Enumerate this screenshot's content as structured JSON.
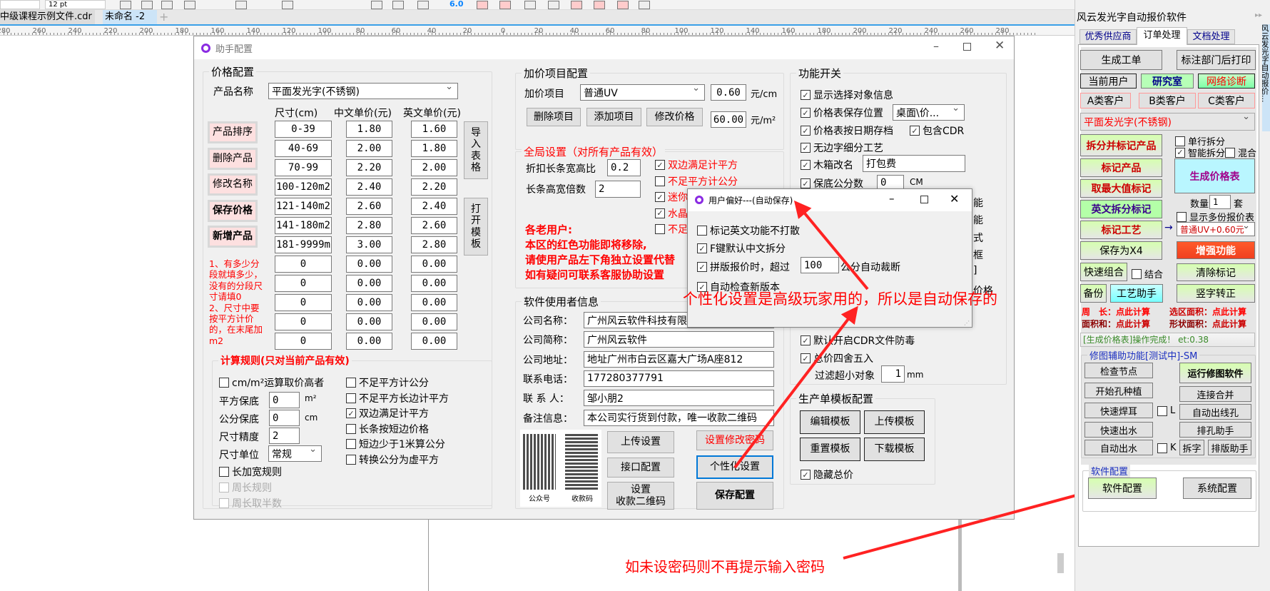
{
  "toolbar": {
    "font_size": "12 pt",
    "outline_width": "6.0"
  },
  "doc_tabs": [
    {
      "label": "中级课程示例文件.cdr"
    },
    {
      "label": "未命名 -2"
    }
  ],
  "new_tab_label": "+",
  "ruler_labels": [
    "280",
    "260",
    "240",
    "220",
    "200",
    "180",
    "160",
    "140",
    "120",
    "100",
    "80",
    "60",
    "40",
    "20",
    "0",
    "20",
    "40",
    "60",
    "80",
    "100",
    "120",
    "140",
    "160",
    "180",
    "200",
    "220",
    "240",
    "260",
    "280"
  ],
  "dialog": {
    "title": "助手配置",
    "price_config": {
      "title": "价格配置",
      "product_label": "产品名称",
      "product_value": "平面发光字(不锈钢)",
      "col_size": "尺寸(cm)",
      "col_cn": "中文单价(元)",
      "col_en": "英文单价(元)",
      "buttons": [
        "产品排序",
        "删除产品",
        "修改名称",
        "保存价格",
        "新增产品"
      ],
      "rows": [
        [
          "0-39",
          "1.80",
          "1.60"
        ],
        [
          "40-69",
          "2.00",
          "1.80"
        ],
        [
          "70-99",
          "2.20",
          "2.00"
        ],
        [
          "100-120m2",
          "2.40",
          "2.20"
        ],
        [
          "121-140m2",
          "2.60",
          "2.40"
        ],
        [
          "141-180m2",
          "2.80",
          "2.60"
        ],
        [
          "181-9999m",
          "3.00",
          "2.80"
        ],
        [
          "0",
          "0.00",
          "0.00"
        ],
        [
          "0",
          "0.00",
          "0.00"
        ],
        [
          "0",
          "0.00",
          "0.00"
        ],
        [
          "0",
          "0.00",
          "0.00"
        ],
        [
          "0",
          "0.00",
          "0.00"
        ]
      ],
      "import_table": "导入表格",
      "open_template": "打开模板",
      "note1": "1、有多少分段就填多少，没有的分段尺寸请填0",
      "note2": "2、尺寸中要按平方计价的，在末尾加m2"
    },
    "calc_rules": {
      "title": "计算规则(只对当前产品有效)",
      "cm_m2_high": {
        "label": "cm/m²运算取价高者",
        "checked": false
      },
      "sq_min_label": "平方保底",
      "sq_min_value": "0",
      "sq_unit": "m²",
      "cm_min_label": "公分保底",
      "cm_min_value": "0",
      "cm_unit": "cm",
      "precision_label": "尺寸精度",
      "precision_value": "2",
      "unit_label": "尺寸单位",
      "unit_value": "常规",
      "len_plus_width": {
        "label": "长加宽规则",
        "checked": false
      },
      "perimeter": {
        "label": "周长规则",
        "checked": false
      },
      "perimeter_half": {
        "label": "周长取半数",
        "checked": false
      },
      "right": [
        {
          "label": "不足平方计公分",
          "checked": false
        },
        {
          "label": "不足平方长边计平方",
          "checked": false
        },
        {
          "label": "双边满足计平方",
          "checked": true
        },
        {
          "label": "长条按短边价格",
          "checked": false
        },
        {
          "label": "短边少于1米算公分",
          "checked": false
        },
        {
          "label": "转换公分为虚平方",
          "checked": false
        }
      ]
    },
    "surcharge": {
      "title": "加价项目配置",
      "item_label": "加价项目",
      "item_value": "普通UV",
      "price_cm": "0.60",
      "unit_cm": "元/cm",
      "price_m2": "60.00",
      "unit_m2": "元/m²",
      "delete": "删除项目",
      "add": "添加项目",
      "modify": "修改价格"
    },
    "global": {
      "title": "全局设置（对所有产品有效）",
      "ratio_label": "折扣长条宽高比",
      "ratio_value": "0.2",
      "multiple_label": "长条高宽倍数",
      "multiple_value": "2",
      "checks": [
        {
          "label": "双边满足计平方",
          "checked": true
        },
        {
          "label": "不足平方计公分",
          "checked": false
        },
        {
          "label": "迷你",
          "checked": true
        },
        {
          "label": "水晶",
          "checked": true
        },
        {
          "label": "不足",
          "checked": false
        }
      ],
      "notice": [
        "各老用户:",
        "本区的红色功能即将移除,",
        "请使用产品左下角独立设置代替",
        "如有疑问可联系客服协助设置"
      ]
    },
    "user_info": {
      "title": "软件使用者信息",
      "fields": [
        {
          "label": "公司名称：",
          "value": "广州风云软件科技有限公司"
        },
        {
          "label": "公司简称：",
          "value": "广州风云软件"
        },
        {
          "label": "公司地址：",
          "value": "地址广州市白云区嘉大广场A座812"
        },
        {
          "label": "联系电话：",
          "value": "177280377791"
        },
        {
          "label": "联 系 人：",
          "value": "邹小朋2"
        },
        {
          "label": "备注信息：",
          "value": "本公司实行货到付款，唯一收款二维码"
        }
      ],
      "qr1": "公众号",
      "qr2": "收款码",
      "upload": "上传设置",
      "api": "接口配置",
      "set_qr": "设置\n收款二维码",
      "set_pwd": "设置修改密码",
      "personal": "个性化设置",
      "save": "保存配置"
    },
    "switches": {
      "title": "功能开关",
      "show_info": {
        "label": "显示选择对象信息",
        "checked": true
      },
      "save_loc": {
        "label": "价格表保存位置",
        "checked": true,
        "value": "桌面\\价..."
      },
      "by_date": {
        "label": "价格表按日期存档",
        "checked": true
      },
      "include_cdr": {
        "label": "包含CDR",
        "checked": true
      },
      "no_edge": {
        "label": "无边字细分工艺",
        "checked": true
      },
      "box_rename": {
        "label": "木箱改名",
        "checked": true,
        "value": "打包费"
      },
      "min_cm": {
        "label": "保底公分数",
        "checked": true,
        "value": "0",
        "unit": "CM"
      },
      "hidden_tails": [
        "能",
        "能",
        "式",
        "框",
        "]",
        "价格"
      ],
      "antivirus": {
        "label": "默认开启CDR文件防毒",
        "checked": true
      },
      "round": {
        "label": "总价四舍五入",
        "checked": true
      },
      "filter_label": "过滤超小对象",
      "filter_value": "1",
      "filter_unit": "mm"
    },
    "template": {
      "title": "生产单模板配置",
      "edit": "编辑模板",
      "upload": "上传模板",
      "reset": "重置模板",
      "download": "下载模板",
      "hide_total": {
        "label": "隐藏总价",
        "checked": true
      }
    }
  },
  "prefs": {
    "title": "用户偏好---(自动保存)",
    "no_scatter": {
      "label": "标记英文功能不打散",
      "checked": false
    },
    "f_key": {
      "label": "F键默认中文拆分",
      "checked": true
    },
    "cut": {
      "label": "拼版报价时，超过",
      "checked": true,
      "value": "100",
      "suffix": "公分自动裁断"
    },
    "update": {
      "label": "自动检查新版本",
      "checked": true
    }
  },
  "annotations": {
    "personal_note": "个性化设置是高级玩家用的，所以是自动保存的",
    "password_note": "如未设密码则不再提示输入密码"
  },
  "panel": {
    "title": "风云发光字自动报价软件",
    "tabs": [
      "优秀供应商",
      "订单处理",
      "文档处理"
    ],
    "gen_order": "生成工单",
    "print_dept": "标注部门后打印",
    "current_user": "当前用户",
    "lab": "研究室",
    "net_diag": "网络诊断",
    "cust_a": "A类客户",
    "cust_b": "B类客户",
    "cust_c": "C类客户",
    "product": "平面发光字(不锈钢)",
    "split_mark": "拆分并标记产品",
    "single_split": {
      "label": "单行拆分",
      "checked": false
    },
    "smart_split": {
      "label": "智能拆分",
      "checked": true
    },
    "mix": {
      "label": "混合",
      "checked": false
    },
    "mark_product": "标记产品",
    "gen_price": "生成价格表",
    "max_mark": "取最大值标记",
    "qty_label": "数量",
    "qty_value": "1",
    "qty_unit": "套",
    "en_split": "英文拆分标记",
    "multi_sheets": {
      "label": "显示多份报价表",
      "checked": false
    },
    "mark_craft": "标记工艺",
    "arrow": "→",
    "craft_value": "普通UV+0.60元",
    "save_x4": "保存为X4",
    "enhance": "增强功能",
    "quick_combine": "快速组合",
    "combine": {
      "label": "结合",
      "checked": false
    },
    "clear_mark": "清除标记",
    "backup": "备份",
    "craft_helper": "工艺助手",
    "vertical_fix": "竖字转正",
    "perimeter": "周　长：",
    "calc": "点此计算",
    "sel_area": "选区面积：",
    "area_sum": "面积和：",
    "shape_area": "形状面积：",
    "status": "[生成价格表]操作完成！ et:0.38",
    "repair_title": "修图辅助功能[测试中]-SM",
    "check_nodes": "检查节点",
    "run_repair": "运行修图软件",
    "plant_holes": "开始孔种植",
    "connect_merge": "连接合并",
    "quick_weld": "快速焊耳",
    "l_check": {
      "label": "L",
      "checked": false
    },
    "auto_line_hole": "自动出线孔",
    "quick_drain": "快速出水",
    "hole_helper": "排孔助手",
    "auto_drain": "自动出水",
    "k_check": {
      "label": "K",
      "checked": false
    },
    "split_char": "拆字",
    "layout_helper": "排版助手",
    "config_title": "软件配置",
    "software_config": "软件配置",
    "system_config": "系统配置",
    "docker_text": "风云发光字自动报价..."
  }
}
